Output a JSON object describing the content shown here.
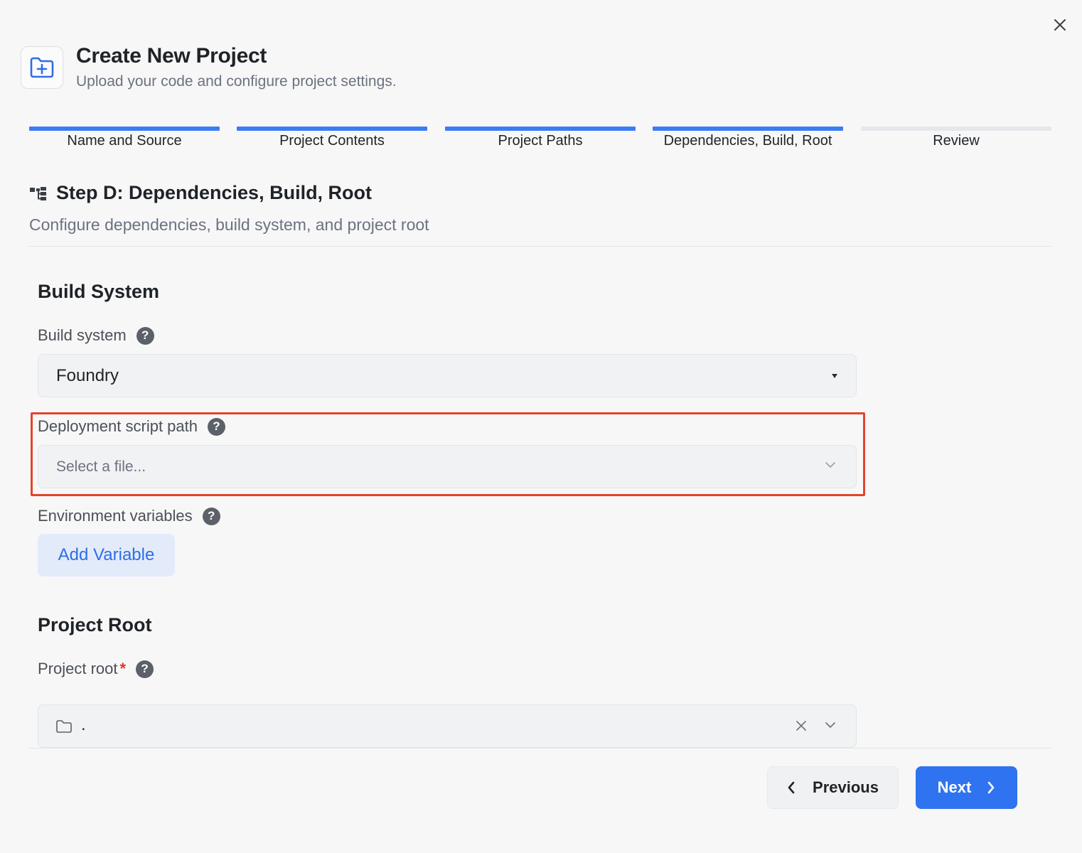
{
  "dialog": {
    "title": "Create New Project",
    "subtitle": "Upload your code and configure project settings."
  },
  "steps": [
    {
      "label": "Name and Source",
      "completed": true
    },
    {
      "label": "Project Contents",
      "completed": true
    },
    {
      "label": "Project Paths",
      "completed": true
    },
    {
      "label": "Dependencies, Build, Root",
      "completed": true
    },
    {
      "label": "Review",
      "completed": false
    }
  ],
  "section": {
    "title": "Step D: Dependencies, Build, Root",
    "description": "Configure dependencies, build system, and project root"
  },
  "build_system": {
    "group_title": "Build System",
    "build_label": "Build system",
    "build_value": "Foundry",
    "script_label": "Deployment script path",
    "script_placeholder": "Select a file...",
    "env_label": "Environment variables",
    "add_variable_label": "Add Variable"
  },
  "project_root": {
    "group_title": "Project Root",
    "label": "Project root",
    "required_mark": "*",
    "value": "."
  },
  "footer": {
    "previous_label": "Previous",
    "next_label": "Next"
  },
  "icons": {
    "close": "close-icon",
    "header": "folder-plus-icon",
    "section": "hierarchy-icon",
    "help": "help-icon",
    "folder": "folder-icon"
  },
  "help_glyph": "?",
  "colors": {
    "accent": "#2f73f0",
    "step_done": "#3b7cf3",
    "step_todo": "#e6e7ea",
    "highlight": "#e2452b",
    "required": "#e5332a"
  }
}
